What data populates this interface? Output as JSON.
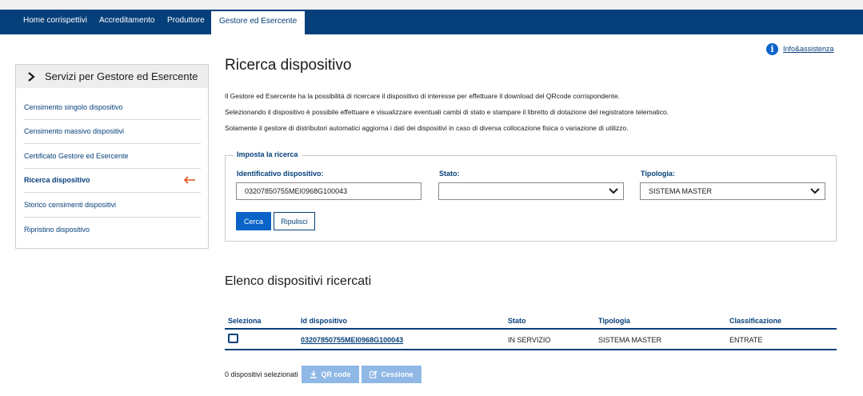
{
  "nav": {
    "items": [
      {
        "label": "Home corrispettivi"
      },
      {
        "label": "Accreditamento"
      },
      {
        "label": "Produttore"
      },
      {
        "label": "Gestore ed Esercente"
      }
    ]
  },
  "header": {
    "info_label": "Info&assistenza"
  },
  "sidebar": {
    "title": "Servizi per Gestore ed Esercente",
    "items": [
      {
        "label": "Censimento singolo dispositivo"
      },
      {
        "label": "Censimento massivo dispositivi"
      },
      {
        "label": "Certificato Gestore ed Esercente"
      },
      {
        "label": "Ricerca dispositivo"
      },
      {
        "label": "Storico censimenti dispositivi"
      },
      {
        "label": "Ripristino dispositivo"
      }
    ]
  },
  "main": {
    "title": "Ricerca dispositivo",
    "description": [
      "Il Gestore ed Esercente ha la possibilità di ricercare il dispositivo di interesse per effettuare il download del QRcode corrispondente.",
      "Selezionando il dispositivo è possibile effettuare e visualizzare eventuali cambi di stato e stampare il libretto di dotazione del registratore telematico.",
      "Solamente il gestore di distributori automatici aggiorna i dati dei dispositivi in caso di diversa collocazione fisica o variazione di utilizzo."
    ]
  },
  "search": {
    "legend": "Imposta la ricerca",
    "id_label": "Identificativo dispositivo:",
    "id_value": "03207850755MEI0968G100043",
    "stato_label": "Stato:",
    "stato_value": "",
    "tipologia_label": "Tipologia:",
    "tipologia_value": "SISTEMA MASTER",
    "cerca_label": "Cerca",
    "ripulisci_label": "Ripulisci"
  },
  "results": {
    "title": "Elenco dispositivi ricercati",
    "columns": [
      "Seleziona",
      "Id dispositivo",
      "Stato",
      "Tipologia",
      "Classificazione"
    ],
    "rows": [
      {
        "id": "03207850755MEI0968G100043",
        "stato": "IN SERVIZIO",
        "tipologia": "SISTEMA MASTER",
        "classificazione": "ENTRATE"
      }
    ],
    "selected_count": "0 dispositivi selezionati",
    "qr_label": "QR code",
    "cessione_label": "Cessione"
  },
  "colors": {
    "brand_blue": "#06407a",
    "accent_blue": "#0a64c8",
    "disabled_blue": "#8fb8e6",
    "active_arrow": "#e5541c"
  }
}
